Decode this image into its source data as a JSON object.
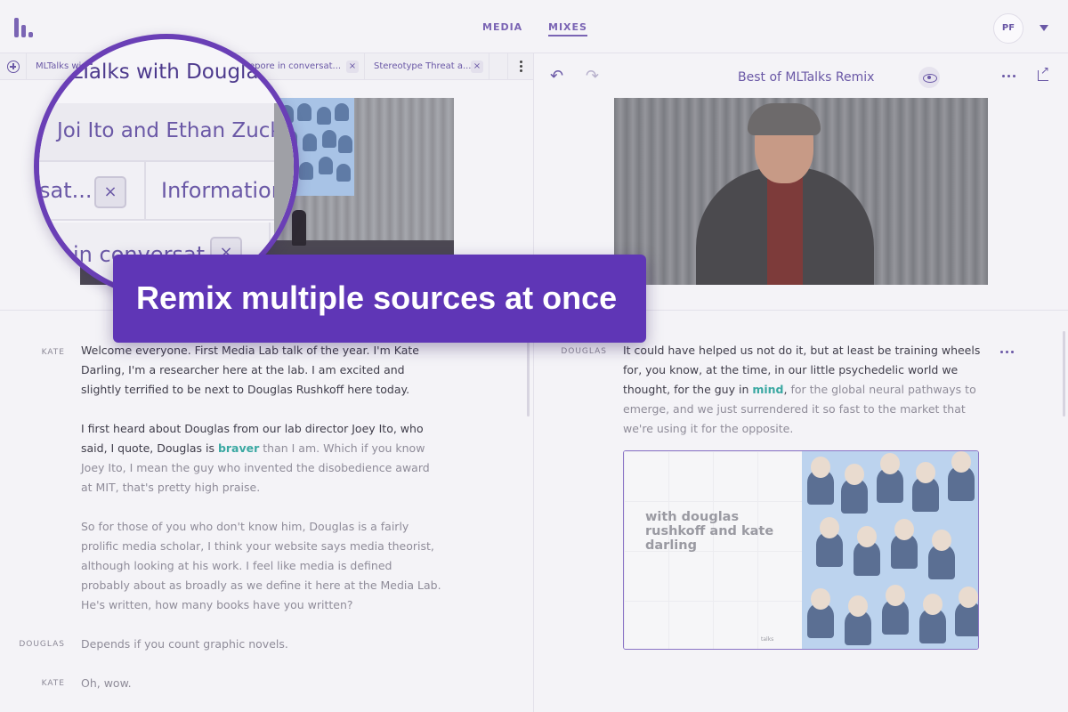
{
  "nav": {
    "media": "MEDIA",
    "mixes": "MIXES"
  },
  "user": {
    "initials": "PF"
  },
  "tabs": [
    {
      "label": "MLTalks wi",
      "close": "×"
    },
    {
      "label": "epore in conversat...",
      "close": "×"
    },
    {
      "label": "Stereotype Threat a...",
      "close": "×"
    }
  ],
  "mix": {
    "title": "Best of MLTalks Remix",
    "undo": "↶",
    "redo": "↷"
  },
  "magnifier": {
    "title": "LTalks with Douglas",
    "subtitle": "Joi Ito and Ethan Zucker",
    "cell1": "sat...",
    "cell2": "Information L",
    "cell3": "in conversat",
    "close": "×"
  },
  "banner": {
    "text": "Remix multiple sources at once"
  },
  "left_transcript": [
    {
      "speaker": "KATE",
      "segments": [
        {
          "text": "Welcome everyone. First Media Lab talk of the year. I'm Kate Darling, I'm a researcher here at the lab. I am excited and slightly terrified to be next to Douglas Rushkoff here today.",
          "style": "normal"
        }
      ]
    },
    {
      "speaker": "",
      "segments": [
        {
          "text": "I first heard about Douglas from our lab director Joey Ito, who said, I quote, Douglas is ",
          "style": "normal"
        },
        {
          "text": "braver",
          "style": "hl"
        },
        {
          "text": " than I am. Which if you know Joey Ito, I mean the guy who invented the disobedience award at MIT, that's pretty high praise.",
          "style": "dim"
        }
      ]
    },
    {
      "speaker": "",
      "segments": [
        {
          "text": "So for those of you who don't know him, Douglas is a fairly prolific media scholar, I think your website says media theorist, although looking at his work. I feel like media is defined probably about as broadly as we define it here at the Media Lab. He's written, how many books have you written?",
          "style": "dim"
        }
      ]
    },
    {
      "speaker": "DOUGLAS",
      "segments": [
        {
          "text": "Depends if you count graphic novels.",
          "style": "dim"
        }
      ]
    },
    {
      "speaker": "KATE",
      "segments": [
        {
          "text": "Oh, wow.",
          "style": "dim"
        }
      ]
    }
  ],
  "right_transcript": {
    "speaker": "DOUGLAS",
    "segments": [
      {
        "text": "It could have helped us not do it, but at least be training wheels for, you know, at the time, in our little psychedelic world we thought, for the guy in ",
        "style": "normal"
      },
      {
        "text": "mind",
        "style": "hl"
      },
      {
        "text": ",",
        "style": "normal"
      },
      {
        "text": " for the global neural pathways to emerge, and we just surrendered it so fast to the market that we're using it for the opposite.",
        "style": "dim"
      }
    ]
  },
  "thumbnail": {
    "title": "with douglas rushkoff and kate darling",
    "brand": "talks"
  },
  "colors": {
    "accent": "#6a58a6",
    "banner": "#5f36b6",
    "highlight": "#3aa8a2"
  }
}
